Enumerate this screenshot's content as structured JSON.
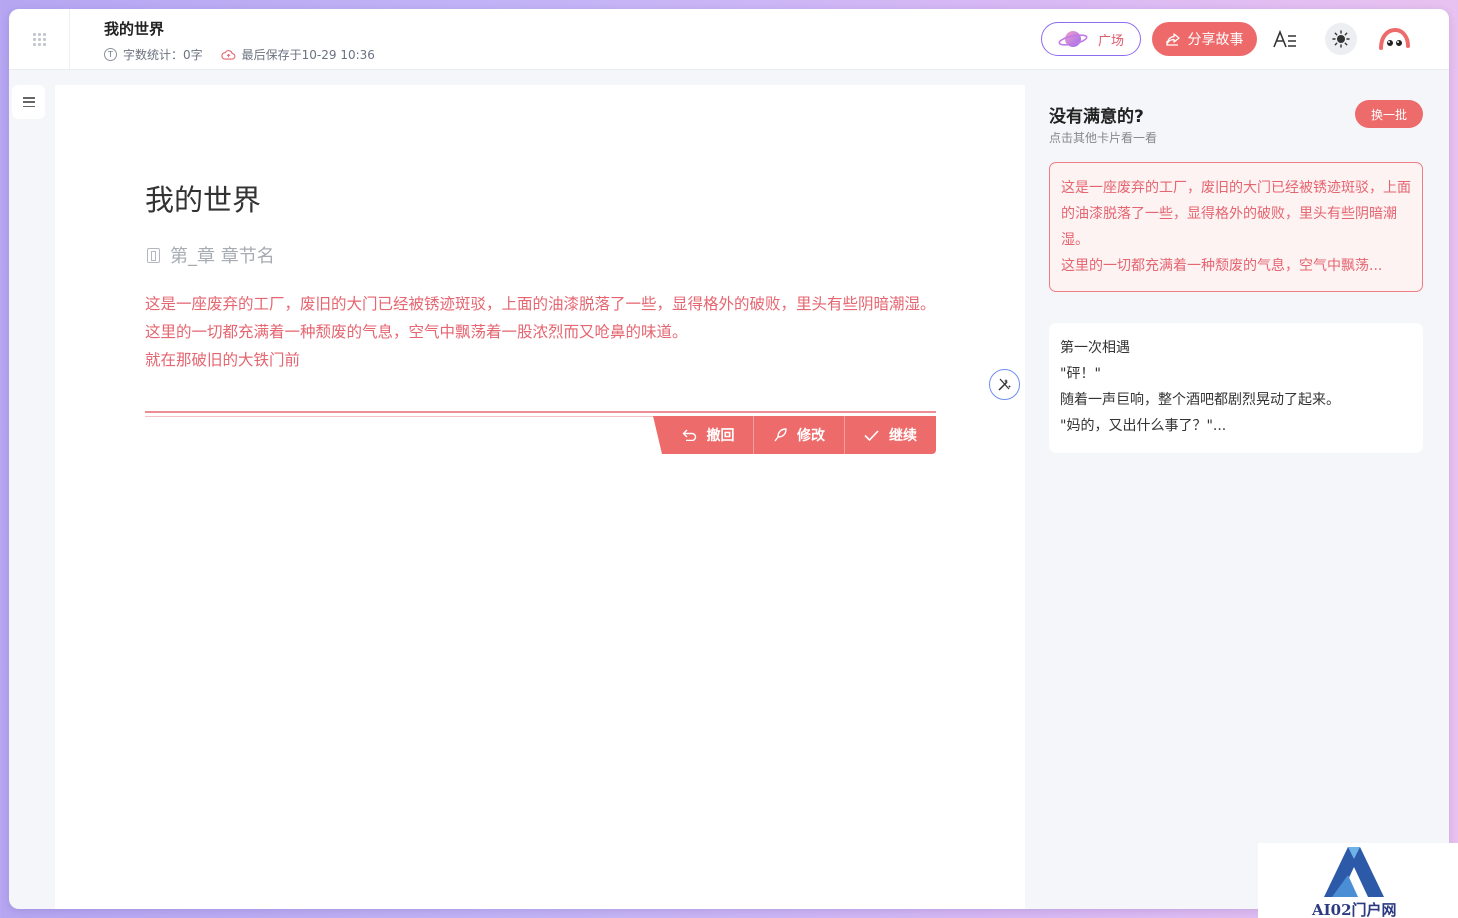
{
  "header": {
    "doc_title": "我的世界",
    "word_count": "字数统计：0字",
    "last_saved": "最后保存于10-29 10:36",
    "plaza_label": "广场",
    "share_label": "分享故事",
    "font_icon_text": "A☰"
  },
  "editor": {
    "chapter_title": "我的世界",
    "section_placeholder": "第_章 章节名",
    "generated_lines": [
      "这是一座废弃的工厂，废旧的大门已经被锈迹斑驳，上面的油漆脱落了一些，显得格外的破败，里头有些阴暗潮湿。",
      "这里的一切都充满着一种颓废的气息，空气中飘荡着一股浓烈而又呛鼻的味道。",
      "就在那破旧的大铁门前"
    ],
    "actions": {
      "undo": "撤回",
      "edit": "修改",
      "continue": "继续"
    }
  },
  "panel": {
    "title": "没有满意的?",
    "subtitle": "点击其他卡片看一看",
    "swap_label": "换一批",
    "cards": [
      {
        "lines": [
          "这是一座废弃的工厂，废旧的大门已经被锈迹斑驳，上面的油漆脱落了一些，显得格外的破败，里头有些阴暗潮湿。",
          "这里的一切都充满着一种颓废的气息，空气中飘荡..."
        ]
      },
      {
        "lines": [
          "第一次相遇",
          "\"砰！\"",
          "随着一声巨响，整个酒吧都剧烈晃动了起来。",
          "\"妈的，又出什么事了？\"..."
        ]
      }
    ]
  },
  "watermark": {
    "text": "AI02门户网"
  },
  "colors": {
    "accent": "#ee6b6b",
    "generated_text": "#e56570",
    "plaza_border": "#8e6cf2"
  }
}
